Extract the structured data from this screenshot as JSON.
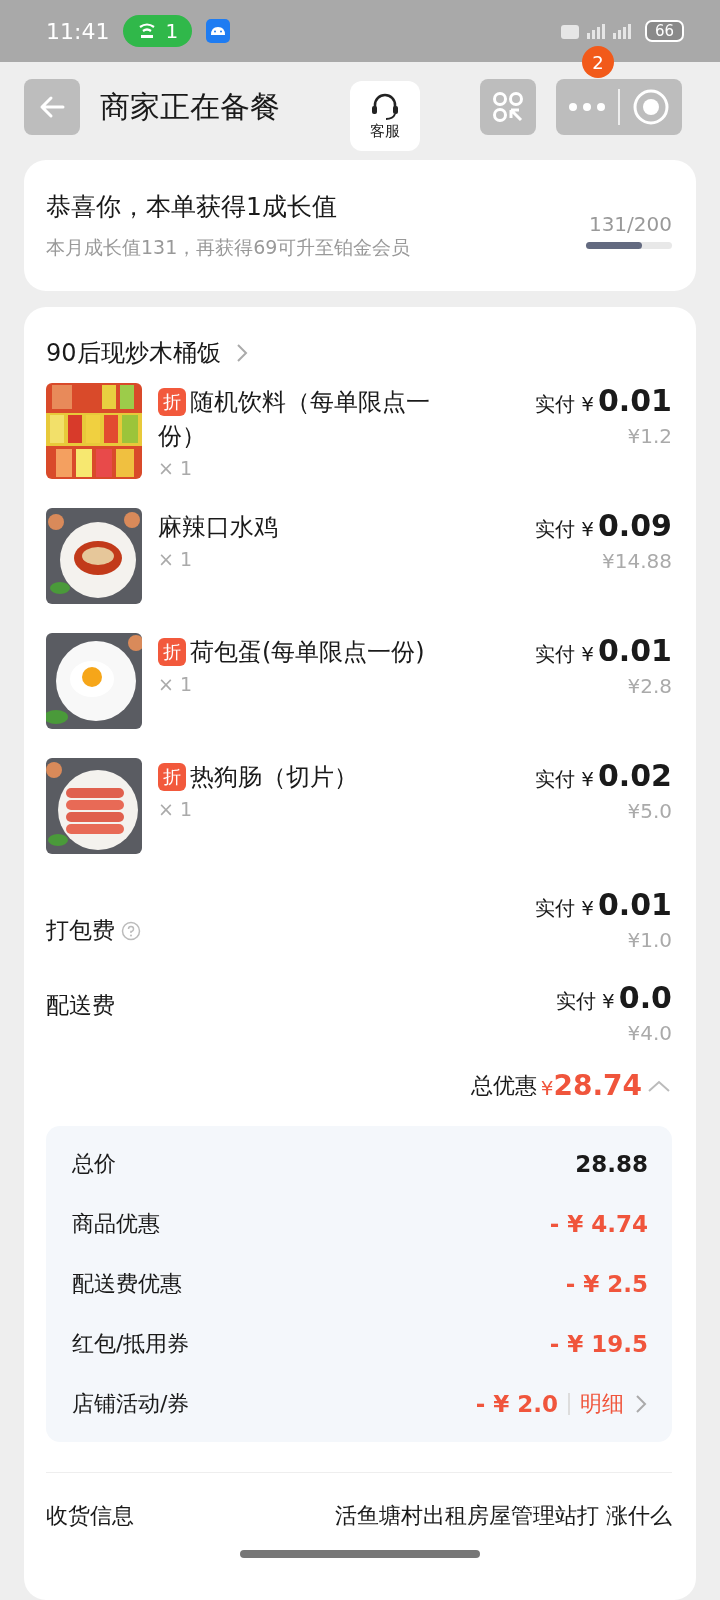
{
  "status_bar": {
    "time": "11:41",
    "hotspot_count": "1",
    "battery": "66"
  },
  "header": {
    "title": "商家正在备餐",
    "service_label": "客服",
    "badge": "2"
  },
  "growth": {
    "title": "恭喜你，本单获得1成长值",
    "subtitle": "本月成长值131，再获得69可升至铂金会员",
    "progress_text": "131/200",
    "level": 0.65
  },
  "store": {
    "name": "90后现炒木桶饭",
    "items": [
      {
        "tag": "折",
        "name": "随机饮料（每单限点一份）",
        "qty": "× 1",
        "paid_label": "实付",
        "currency": "¥",
        "paid": "0.01",
        "original": "¥1.2"
      },
      {
        "name": "麻辣口水鸡",
        "qty": "× 1",
        "paid_label": "实付",
        "currency": "¥",
        "paid": "0.09",
        "original": "¥14.88"
      },
      {
        "tag": "折",
        "name": "荷包蛋(每单限点一份)",
        "qty": "× 1",
        "paid_label": "实付",
        "currency": "¥",
        "paid": "0.01",
        "original": "¥2.8"
      },
      {
        "tag": "折",
        "name": "热狗肠（切片）",
        "qty": "× 1",
        "paid_label": "实付",
        "currency": "¥",
        "paid": "0.02",
        "original": "¥5.0"
      }
    ],
    "fees": [
      {
        "name": "打包费",
        "help": true,
        "paid_label": "实付",
        "currency": "¥",
        "paid": "0.01",
        "original": "¥1.0"
      },
      {
        "name": "配送费",
        "help": false,
        "paid_label": "实付",
        "currency": "¥",
        "paid": "0.0",
        "original": "¥4.0"
      }
    ],
    "total_discount": {
      "label": "总优惠",
      "currency": "¥",
      "amount": "28.74",
      "expanded": true
    },
    "summary": [
      {
        "label": "总价",
        "value": "28.88",
        "kind": "plain"
      },
      {
        "label": "商品优惠",
        "value": "- ¥ 4.74",
        "kind": "discount"
      },
      {
        "label": "配送费优惠",
        "value": "- ¥ 2.5",
        "kind": "discount"
      },
      {
        "label": "红包/抵用券",
        "value": "- ¥ 19.5",
        "kind": "discount"
      },
      {
        "label": "店铺活动/券",
        "value": "- ¥ 2.0",
        "kind": "discount",
        "link": "明细"
      }
    ]
  },
  "delivery": {
    "label": "收货信息",
    "value": "活鱼塘村出租房屋管理站打 涨什么"
  }
}
